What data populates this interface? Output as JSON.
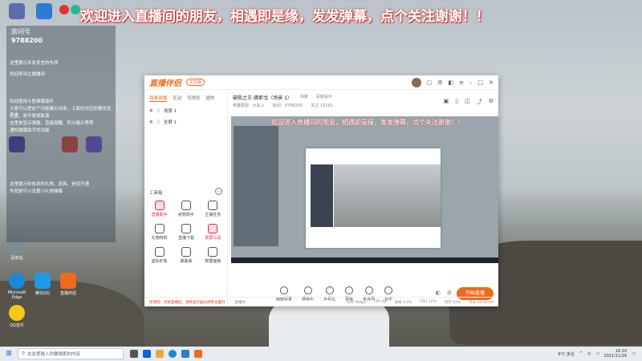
{
  "banner": {
    "text": "欢迎进入直播间的朋友，相遇即是缘，发发弹幕，点个关注谢谢！！"
  },
  "overlay": {
    "room_label": "房间号",
    "room_number": "9788200",
    "chat": [
      "这里展示永友发言的东西",
      "欢迎来到主播播间",
      "欢迎使用斗鱼弹幕插件",
      "大家可以把这个功能展示出来，上面的对应的要改变大小",
      "位置，是不是很新潮",
      "这里是显示弹幕、直接提醒、积分展示等等",
      "通知弹幕助手的功能",
      "这里展示你收到的礼物、道具、是就开通",
      "你就是可以设置小礼物弹幕"
    ]
  },
  "desktop_icons": [
    {
      "label": "",
      "color": "#5a6fa8"
    },
    {
      "label": "",
      "color": "#2d7bd3"
    },
    {
      "label": "",
      "color": "#3b3b9b"
    },
    {
      "label": "",
      "color": "#c8402c"
    },
    {
      "label": "",
      "color": "#6a4ac2"
    },
    {
      "label": "回收站",
      "color": "#7d8c94"
    },
    {
      "label": "Microsoft Edge",
      "color": "#1b8ad6"
    },
    {
      "label": "QQ音乐",
      "color": "#f5c518"
    },
    {
      "label": "腾讯QQ",
      "color": "#1f9ae3"
    },
    {
      "label": "直播伴侣",
      "color": "#f06a1c"
    }
  ],
  "window": {
    "logo": "直播伴侣",
    "version": "正式版",
    "side_tabs": [
      "场景录播",
      "互动",
      "可视化",
      "插件"
    ],
    "scenes": [
      "场景 1",
      "全屏 1"
    ],
    "tools_label": "工具箱",
    "tools_more": "…",
    "tools": [
      {
        "label": "直播助手",
        "red": true
      },
      {
        "label": "房管助手",
        "red": false
      },
      {
        "label": "主播任务",
        "red": false
      },
      {
        "label": "礼物特效",
        "red": false
      },
      {
        "label": "直播下载",
        "red": false
      },
      {
        "label": "录屏工具",
        "red": true
      },
      {
        "label": "虚拟形象",
        "red": false
      },
      {
        "label": "弹幕库",
        "red": false
      },
      {
        "label": "数据面板",
        "red": false
      }
    ],
    "main_title": "破败之王-佛耶戈（场景 1）",
    "main_tabs": [
      "场景",
      "更新提示"
    ],
    "meta": [
      "英雄联盟 · 大乱斗",
      "房间：9788200",
      "关注 13181"
    ],
    "controls": [
      "画面设置",
      "摄像头",
      "多机位",
      "录像",
      "麦克风",
      "音乐"
    ],
    "go_live": "开始直播",
    "status_warning": "检测到：开始直播前，请将显示器分辨率设置好",
    "status_note": "直播中",
    "stats": [
      "码率 0kbps",
      "FPS 60",
      "丢帧 0.0%",
      "CPU 12%",
      "内存 63%",
      "时长 00:00:00"
    ]
  },
  "taskbar": {
    "search_placeholder": "在这里输入你要搜索的内容",
    "temperature": "9°C 多云",
    "time": "16:10",
    "date": "2021/11/26"
  }
}
